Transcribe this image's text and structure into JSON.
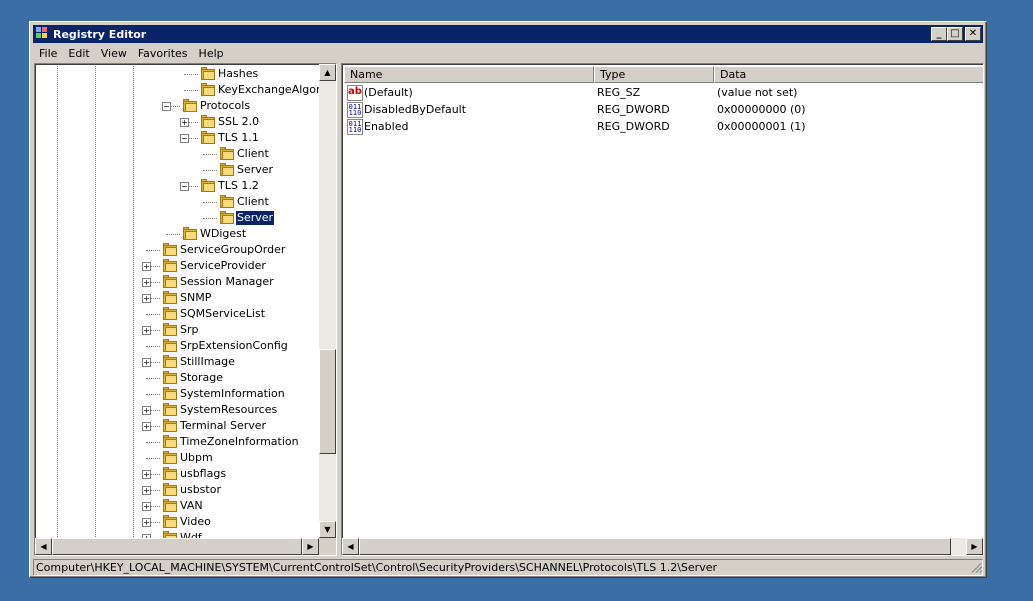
{
  "window": {
    "title": "Registry Editor",
    "minimize_glyph": "_",
    "maximize_glyph": "□",
    "close_glyph": "✕"
  },
  "menu": [
    "File",
    "Edit",
    "View",
    "Favorites",
    "Help"
  ],
  "tree": {
    "nodes": [
      {
        "label": "Hashes",
        "expander": ""
      },
      {
        "label": "KeyExchangeAlgorithms",
        "expander": ""
      },
      {
        "label": "Protocols",
        "expander": "−"
      },
      {
        "label": "SSL 2.0",
        "expander": "+"
      },
      {
        "label": "TLS 1.1",
        "expander": "−"
      },
      {
        "label": "Client",
        "expander": ""
      },
      {
        "label": "Server",
        "expander": ""
      },
      {
        "label": "TLS 1.2",
        "expander": "−"
      },
      {
        "label": "Client",
        "expander": ""
      },
      {
        "label": "Server",
        "expander": "",
        "selected": true
      },
      {
        "label": "WDigest",
        "expander": ""
      },
      {
        "label": "ServiceGroupOrder",
        "expander": ""
      },
      {
        "label": "ServiceProvider",
        "expander": "+"
      },
      {
        "label": "Session Manager",
        "expander": "+"
      },
      {
        "label": "SNMP",
        "expander": "+"
      },
      {
        "label": "SQMServiceList",
        "expander": ""
      },
      {
        "label": "Srp",
        "expander": "+"
      },
      {
        "label": "SrpExtensionConfig",
        "expander": ""
      },
      {
        "label": "StillImage",
        "expander": "+"
      },
      {
        "label": "Storage",
        "expander": ""
      },
      {
        "label": "SystemInformation",
        "expander": ""
      },
      {
        "label": "SystemResources",
        "expander": "+"
      },
      {
        "label": "Terminal Server",
        "expander": "+"
      },
      {
        "label": "TimeZoneInformation",
        "expander": ""
      },
      {
        "label": "Ubpm",
        "expander": ""
      },
      {
        "label": "usbflags",
        "expander": "+"
      },
      {
        "label": "usbstor",
        "expander": "+"
      },
      {
        "label": "VAN",
        "expander": "+"
      },
      {
        "label": "Video",
        "expander": "+"
      },
      {
        "label": "Wdf",
        "expander": "+"
      }
    ]
  },
  "list": {
    "columns": [
      "Name",
      "Type",
      "Data"
    ],
    "rows": [
      {
        "icon": "string-value-icon",
        "icon_text": "ab",
        "name": "(Default)",
        "type": "REG_SZ",
        "data": "(value not set)"
      },
      {
        "icon": "binary-value-icon",
        "icon_text": "011\n110",
        "name": "DisabledByDefault",
        "type": "REG_DWORD",
        "data": "0x00000000 (0)"
      },
      {
        "icon": "binary-value-icon",
        "icon_text": "011\n110",
        "name": "Enabled",
        "type": "REG_DWORD",
        "data": "0x00000001 (1)"
      }
    ]
  },
  "scroll_glyphs": {
    "up": "▲",
    "down": "▼",
    "left": "◀",
    "right": "▶"
  },
  "status": {
    "path": "Computer\\HKEY_LOCAL_MACHINE\\SYSTEM\\CurrentControlSet\\Control\\SecurityProviders\\SCHANNEL\\Protocols\\TLS 1.2\\Server"
  },
  "colors": {
    "desktop": "#3a6ea5",
    "titlebar": "#0a246a",
    "face": "#d4d0c8",
    "selection": "#0a246a"
  }
}
